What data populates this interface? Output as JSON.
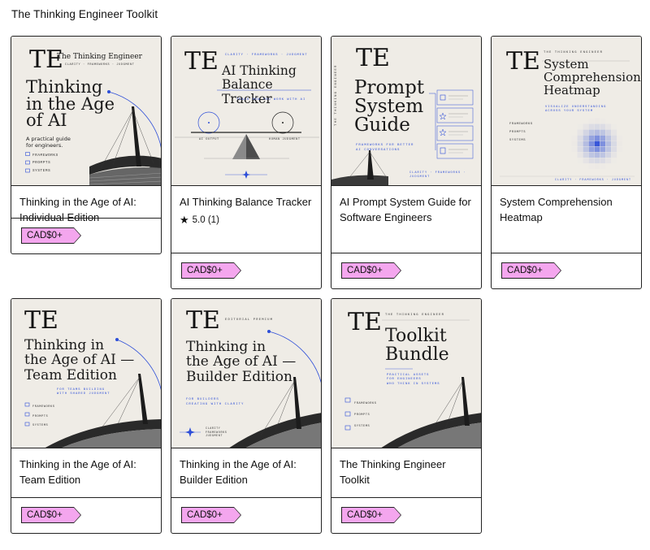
{
  "section_title": "The Thinking Engineer Toolkit",
  "colors": {
    "price_badge": "#f4a6ee",
    "accent_blue": "#2d4ed8",
    "cover_bg": "#efece6"
  },
  "products": [
    {
      "title": "Thinking in the Age of AI: Individual Edition",
      "price": "CAD$0+",
      "cover": {
        "monogram": "TE",
        "brand": "The Thinking Engineer",
        "tagline": "CLARITY · FRAMEWORKS · JUDGMENT",
        "headline": [
          "Thinking",
          "in the Age",
          "of AI"
        ],
        "subline": [
          "A practical guide",
          "for engineers."
        ],
        "items": [
          "FRAMEWORKS",
          "PROMPTS",
          "SYSTEMS"
        ]
      }
    },
    {
      "title": "AI Thinking Balance Tracker",
      "price": "CAD$0+",
      "rating": "5.0 (1)",
      "cover": {
        "monogram": "TE",
        "tagline": "CLARITY · FRAMEWORKS · JUDGMENT",
        "headline": [
          "AI Thinking",
          "Balance Tracker"
        ],
        "subline": "TRACK HOW YOU WORK WITH AI",
        "left_label": "AI OUTPUT",
        "right_label": "HUMAN JUDGMENT"
      }
    },
    {
      "title": "AI Prompt System Guide for Software Engineers",
      "price": "CAD$0+",
      "cover": {
        "monogram": "TE",
        "vertical": "THE THINKING ENGINEER",
        "headline": [
          "Prompt",
          "System",
          "Guide"
        ],
        "subline": [
          "FRAMEWORKS FOR BETTER",
          "AI CONVERSATIONS"
        ],
        "footer": "CLARITY · FRAMEWORKS · JUDGMENT"
      }
    },
    {
      "title": "System Comprehension Heatmap",
      "price": "CAD$0+",
      "cover": {
        "monogram": "TE",
        "brand": "THE THINKING ENGINEER",
        "headline": [
          "System",
          "Comprehension",
          "Heatmap"
        ],
        "subline": [
          "VISUALIZE UNDERSTANDING",
          "ACROSS YOUR SYSTEM"
        ],
        "items": [
          "FRAMEWORKS",
          "PROMPTS",
          "SYSTEMS"
        ],
        "footer": "CLARITY · FRAMEWORKS · JUDGMENT"
      }
    },
    {
      "title": "Thinking in the Age of AI: Team Edition",
      "price": "CAD$0+",
      "cover": {
        "monogram": "TE",
        "headline": [
          "Thinking in",
          "the Age of AI —",
          "Team Edition"
        ],
        "subline": [
          "FOR TEAMS BUILDING",
          "WITH SHARED JUDGMENT"
        ],
        "items": [
          "FRAMEWORKS",
          "PROMPTS",
          "SYSTEMS"
        ]
      }
    },
    {
      "title": "Thinking in the Age of AI: Builder Edition",
      "price": "CAD$0+",
      "cover": {
        "monogram": "TE",
        "tagline": "EDITORIAL PREMIUM",
        "headline": [
          "Thinking in",
          "the Age of AI —",
          "Builder Edition"
        ],
        "subline": [
          "FOR BUILDERS",
          "CREATING WITH CLARITY"
        ],
        "items": [
          "CLARITY",
          "FRAMEWORKS",
          "JUDGMENT"
        ]
      }
    },
    {
      "title": "The Thinking Engineer Toolkit",
      "price": "CAD$0+",
      "cover": {
        "monogram": "TE",
        "brand": "THE THINKING ENGINEER",
        "headline": [
          "Toolkit",
          "Bundle"
        ],
        "subline": [
          "PRACTICAL ASSETS",
          "FOR ENGINEERS",
          "WHO THINK IN SYSTEMS"
        ],
        "items": [
          "FRAMEWORKS",
          "PROMPTS",
          "SYSTEMS"
        ]
      }
    }
  ]
}
